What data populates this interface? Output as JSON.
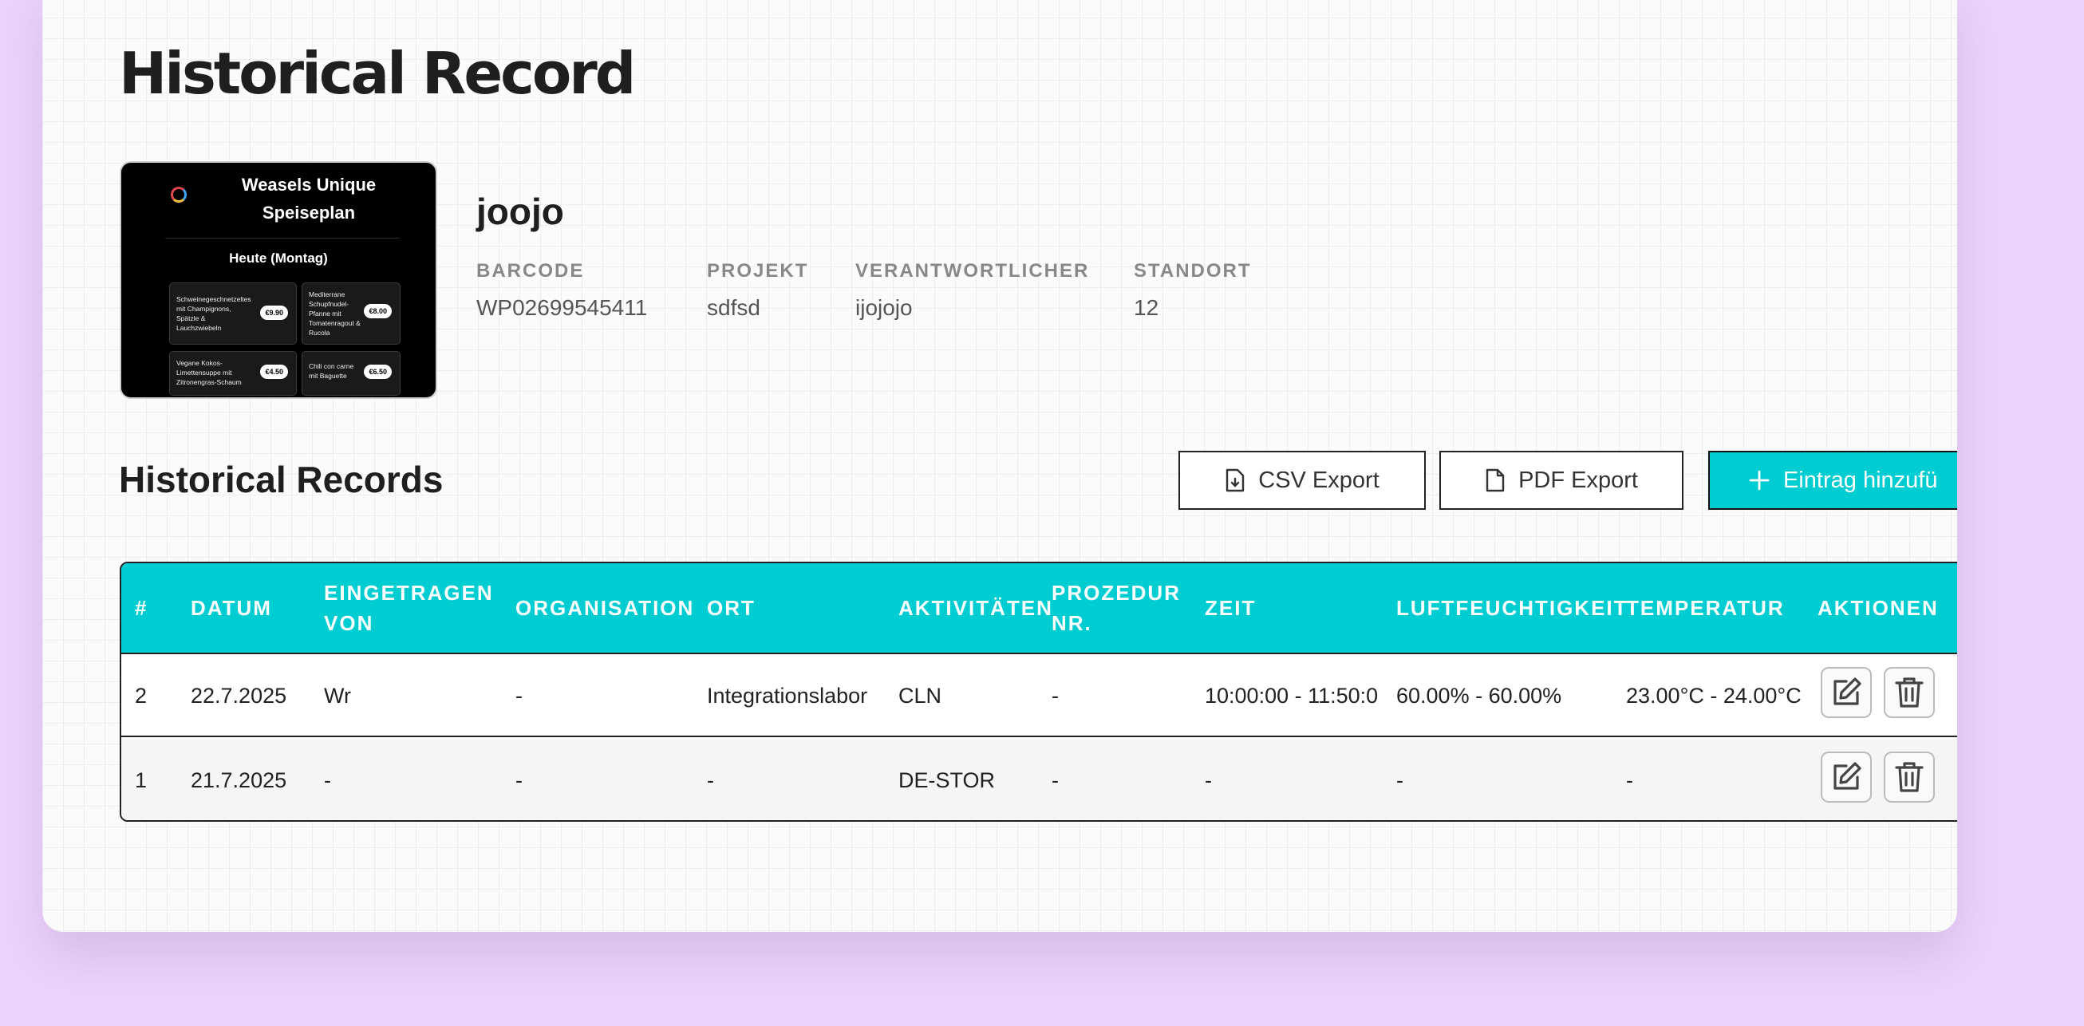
{
  "page": {
    "title": "Historical Record",
    "entity_name": "joojo"
  },
  "thumbnail": {
    "title": "Weasels Unique Speiseplan",
    "day": "Heute (Montag)",
    "items": [
      {
        "name": "Schweinegeschnetzeltes mit Champignons, Spätzle & Lauchzwiebeln",
        "price": "€9.90"
      },
      {
        "name": "Mediterrane Schupfnudel-Pfanne mit Tomatenragout & Rucola",
        "price": "€8.00"
      },
      {
        "name": "Vegane Kokos-Limettensuppe mit Zitronengras-Schaum",
        "price": "€4.50"
      },
      {
        "name": "Chili con carne mit Baguette",
        "price": "€6.50"
      }
    ]
  },
  "meta": {
    "barcode_label": "BARCODE",
    "barcode_value": "WP02699545411",
    "projekt_label": "PROJEKT",
    "projekt_value": "sdfsd",
    "verantwortlicher_label": "VERANTWORTLICHER",
    "verantwortlicher_value": "ijojojo",
    "standort_label": "STANDORT",
    "standort_value": "12"
  },
  "section": {
    "title": "Historical Records",
    "csv_label": "CSV Export",
    "pdf_label": "PDF Export",
    "add_label": "Eintrag hinzufü"
  },
  "table": {
    "headers": [
      "#",
      "DATUM",
      "EINGETRAGEN VON",
      "ORGANISATION",
      "ORT",
      "AKTIVITÄTEN",
      "PROZEDUR NR.",
      "ZEIT",
      "LUFTFEUCHTIGKEIT",
      "TEMPERATUR",
      "AKTIONEN"
    ],
    "rows": [
      [
        "2",
        "22.7.2025",
        "Wr",
        "-",
        "Integrationslabor",
        "CLN",
        "-",
        "10:00:00 - 11:50:0",
        "60.00% - 60.00%",
        "23.00°C - 24.00°C"
      ],
      [
        "1",
        "21.7.2025",
        "-",
        "-",
        "-",
        "DE-STOR",
        "-",
        "-",
        "-",
        "-"
      ]
    ]
  },
  "colors": {
    "accent": "#00cdd1",
    "background": "#ecd3fb"
  }
}
